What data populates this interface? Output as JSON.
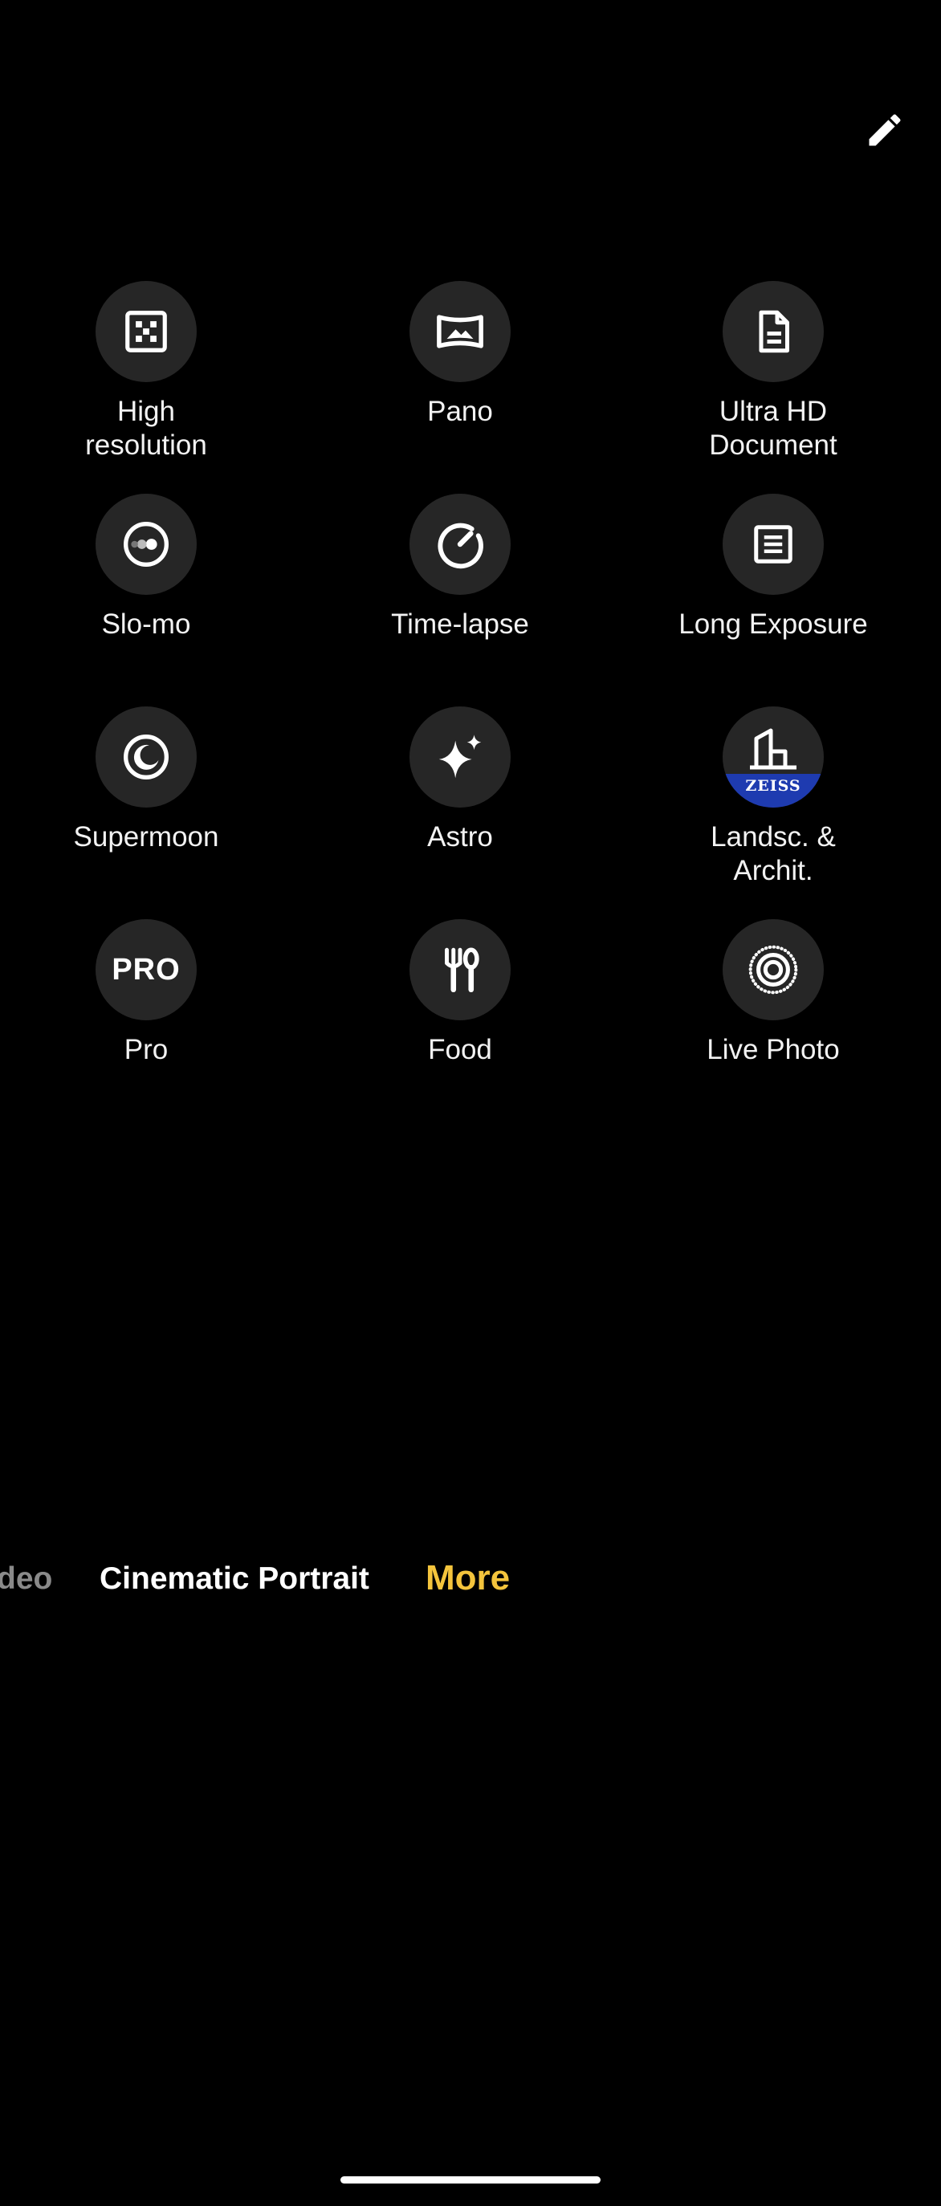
{
  "header": {
    "edit_icon": "pencil-icon"
  },
  "modes_grid": [
    {
      "label": "High\nresolution",
      "icon": "high-resolution-icon"
    },
    {
      "label": "Pano",
      "icon": "pano-icon"
    },
    {
      "label": "Ultra HD\nDocument",
      "icon": "document-icon"
    },
    {
      "label": "Slo-mo",
      "icon": "slo-mo-icon"
    },
    {
      "label": "Time-lapse",
      "icon": "time-lapse-icon"
    },
    {
      "label": "Long Exposure",
      "icon": "long-exposure-icon"
    },
    {
      "label": "Supermoon",
      "icon": "moon-icon"
    },
    {
      "label": "Astro",
      "icon": "sparkle-icon"
    },
    {
      "label": "Landsc. &\nArchit.",
      "icon": "building-zeiss-icon",
      "badge_text": "ZEISS"
    },
    {
      "label": "Pro",
      "icon": "pro-icon",
      "icon_text": "PRO"
    },
    {
      "label": "Food",
      "icon": "fork-knife-icon"
    },
    {
      "label": "Live Photo",
      "icon": "live-photo-icon"
    }
  ],
  "mode_bar": {
    "items": [
      {
        "label": "deo",
        "state": "faded"
      },
      {
        "label": "Cinematic Portrait",
        "state": "normal"
      },
      {
        "label": "More",
        "state": "selected"
      }
    ]
  },
  "colors": {
    "background": "#000000",
    "tile_background": "#262626",
    "accent": "#F4C43C",
    "zeiss_blue": "#1e3bb0",
    "faded_text": "#8a8a8a"
  }
}
